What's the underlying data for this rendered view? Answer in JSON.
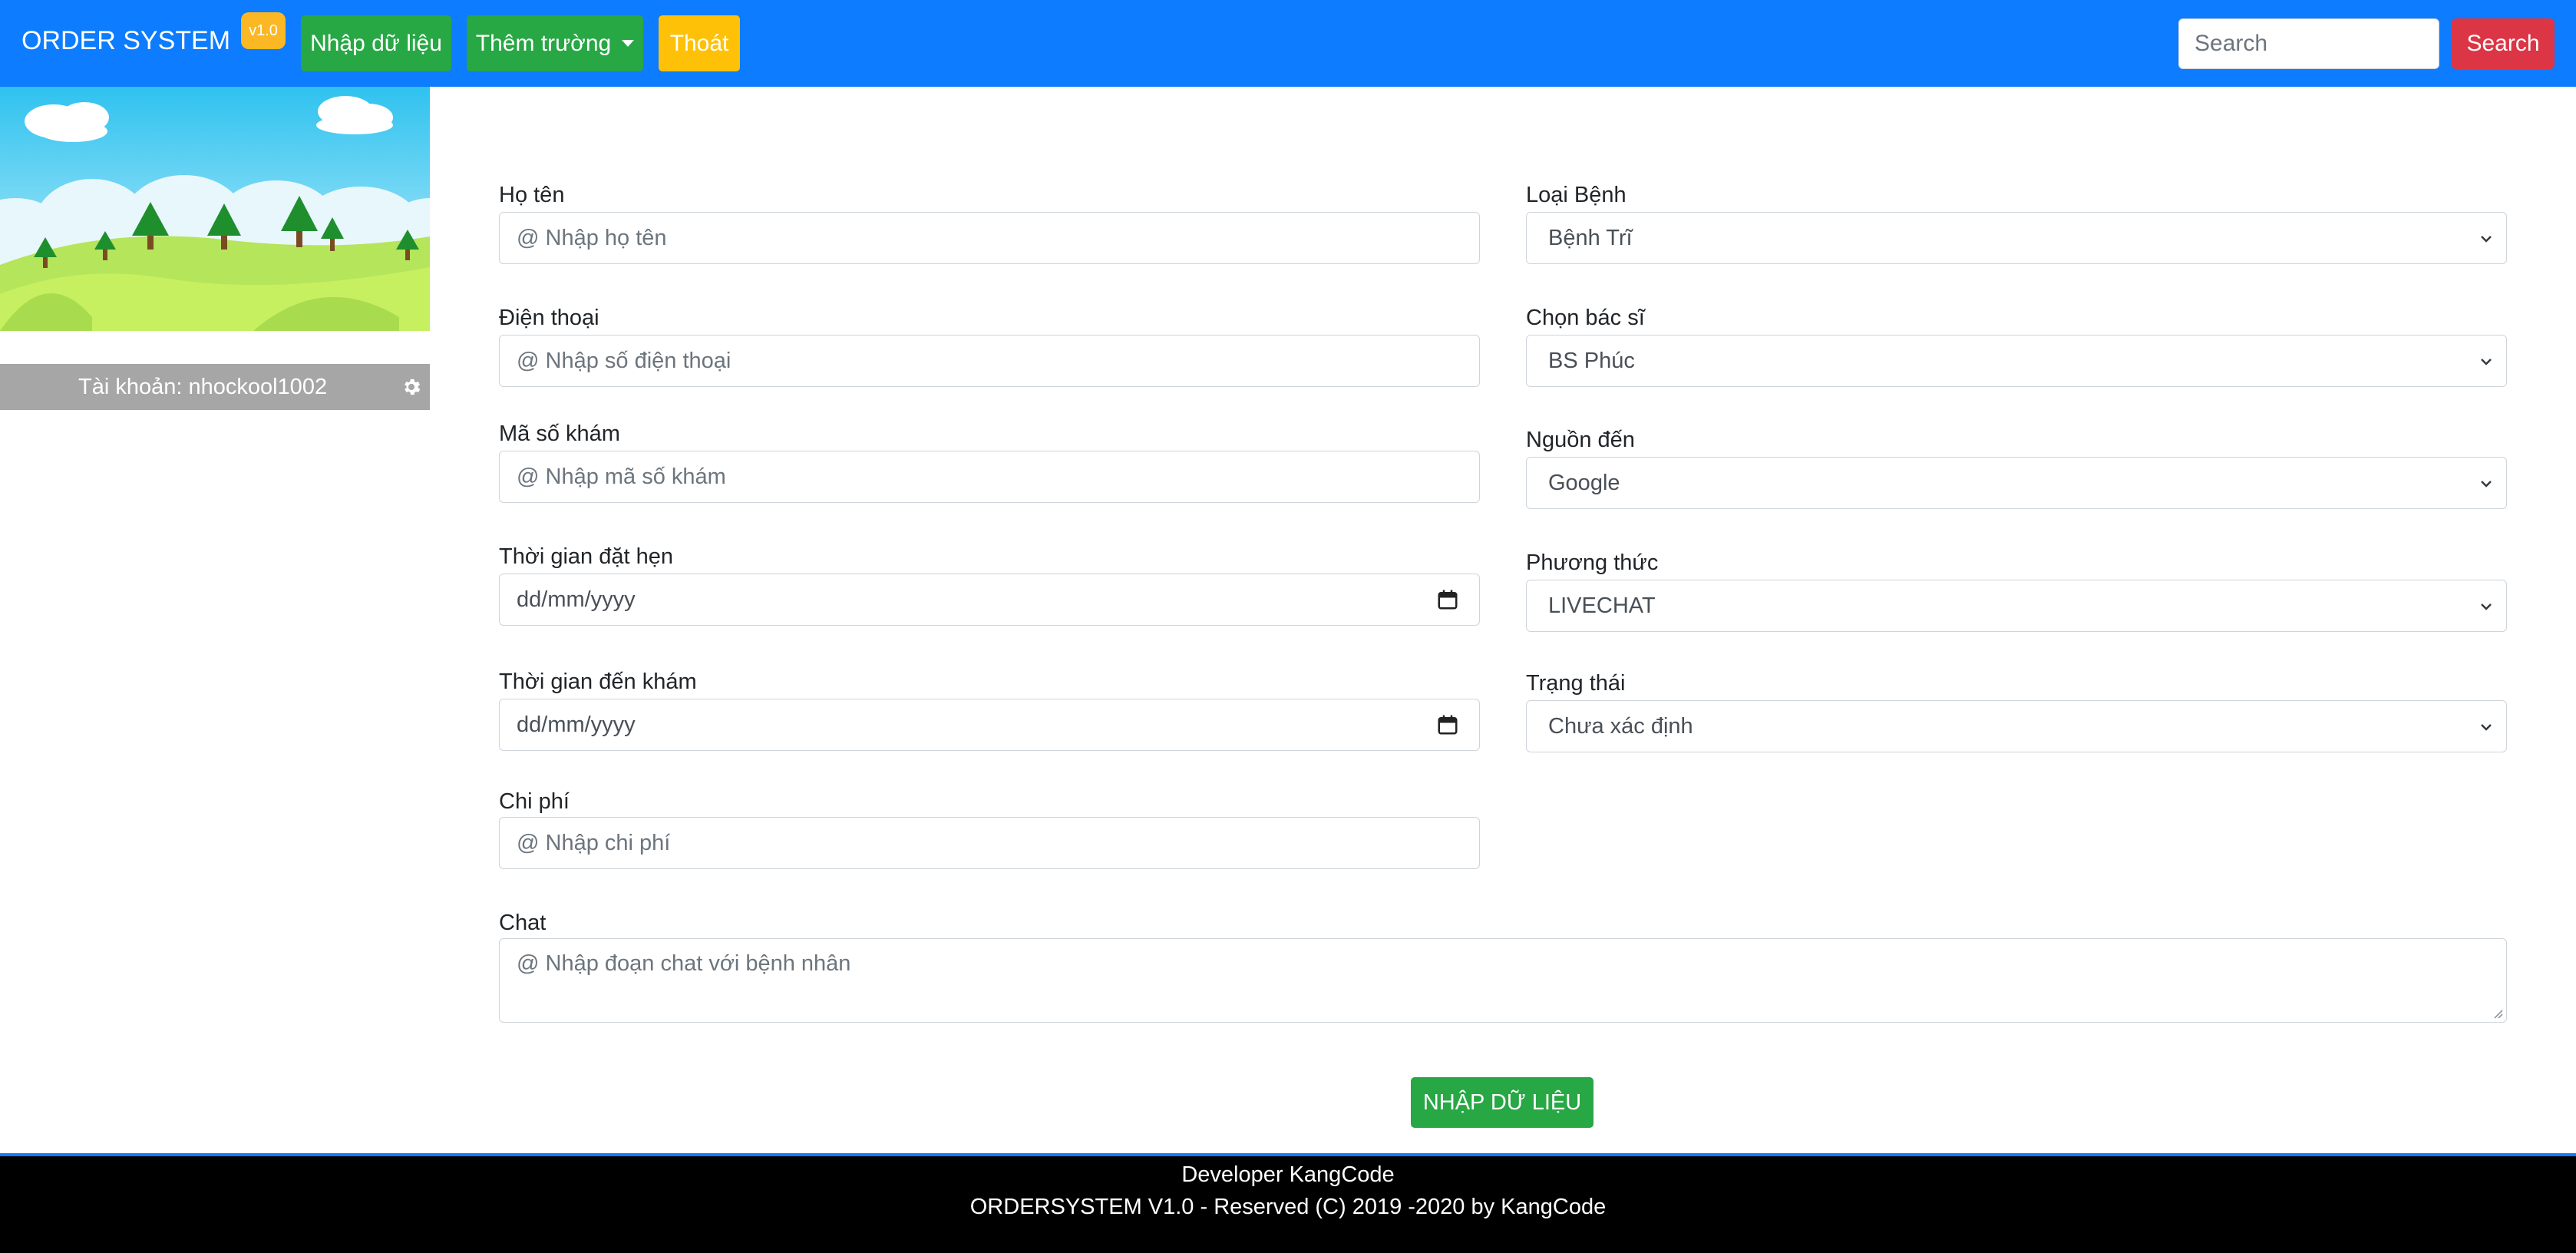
{
  "navbar": {
    "brand": "ORDER SYSTEM",
    "version_badge": "v1.0",
    "enter_data_label": "Nhập dữ liệu",
    "add_field_label": "Thêm trường",
    "exit_label": "Thoát",
    "search_placeholder": "Search",
    "search_button": "Search",
    "colors": {
      "bar": "#0d7cff",
      "green": "#28a745",
      "yellow": "#ffc107",
      "red": "#dc3545"
    }
  },
  "sidebar": {
    "account_text": "Tài khoản: nhockool1002",
    "settings_icon": "gear-icon"
  },
  "form": {
    "name": {
      "label": "Họ tên",
      "placeholder": "@ Nhập họ tên"
    },
    "phone": {
      "label": "Điện thoại",
      "placeholder": "@ Nhập số điện thoại"
    },
    "exam_code": {
      "label": "Mã số khám",
      "placeholder": "@ Nhập mã số khám"
    },
    "appointment_time": {
      "label": "Thời gian đặt hẹn",
      "placeholder": "dd/mm/yyyy"
    },
    "visit_time": {
      "label": "Thời gian đến khám",
      "placeholder": "dd/mm/yyyy"
    },
    "cost": {
      "label": "Chi phí",
      "placeholder": "@ Nhập chi phí"
    },
    "disease_type": {
      "label": "Loại Bệnh",
      "value": "Bệnh Trĩ"
    },
    "doctor": {
      "label": "Chọn bác sĩ",
      "value": "BS Phúc"
    },
    "source": {
      "label": "Nguồn đến",
      "value": "Google"
    },
    "method": {
      "label": "Phương thức",
      "value": "LIVECHAT"
    },
    "status": {
      "label": "Trạng thái",
      "value": "Chưa xác định"
    },
    "chat": {
      "label": "Chat",
      "placeholder": "@ Nhập đoạn chat với bệnh nhân"
    },
    "submit_label": "NHẬP DỮ LIỆU"
  },
  "footer": {
    "line1": "Developer KangCode",
    "line2": "ORDERSYSTEM V1.0 - Reserved (C) 2019 -2020 by KangCode"
  }
}
